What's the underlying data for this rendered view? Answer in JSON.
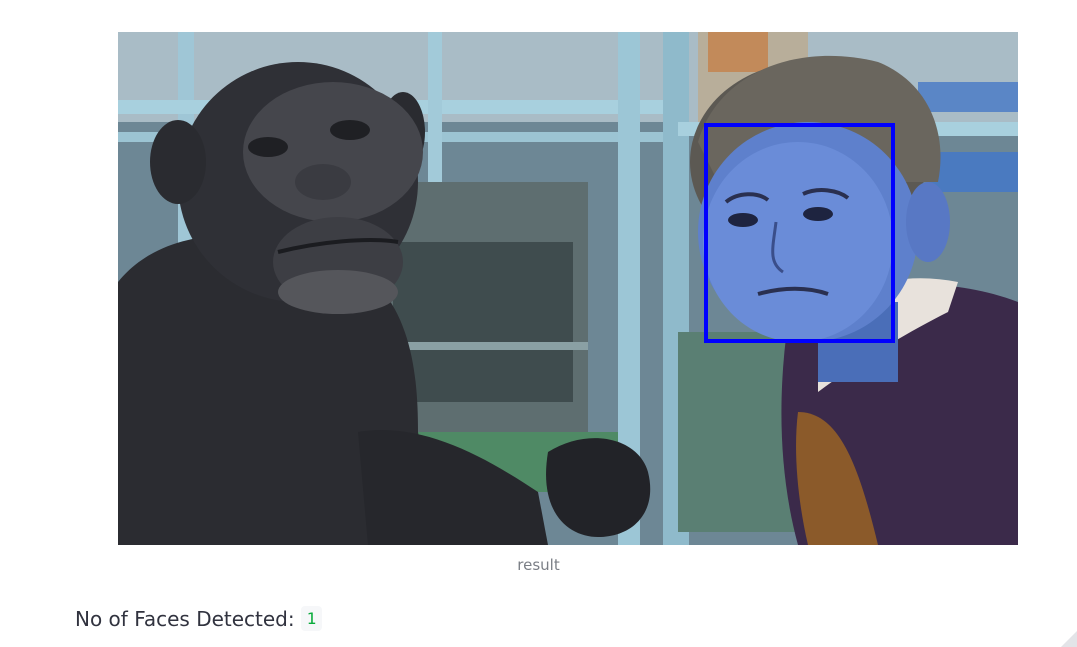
{
  "image": {
    "description_icon": "face-detection-result-photo",
    "detection_box_color": "#0000ff"
  },
  "caption": "result",
  "faces": {
    "label": "No of Faces Detected:",
    "count": "1"
  },
  "colors": {
    "text": "#31333f",
    "caption": "#7b7f86",
    "count": "#09ab3b"
  }
}
